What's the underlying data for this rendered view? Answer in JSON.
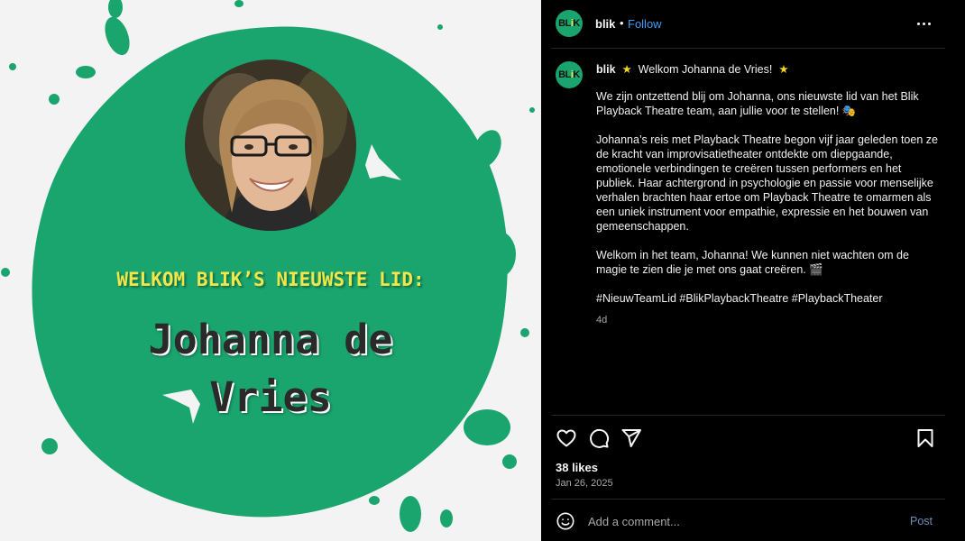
{
  "media": {
    "headline": "WELKOM BLIK’S NIEUWSTE LID:",
    "name": "Johanna de Vries",
    "colors": {
      "splash": "#1aa56e",
      "background": "#f3f3f3",
      "headline": "#f2e64a",
      "name": "#2a2a2a"
    }
  },
  "header": {
    "avatar_text_pre": "BL",
    "avatar_text_accent": "i",
    "avatar_text_post": "K",
    "username": "blik",
    "separator": "•",
    "follow_label": "Follow",
    "more_icon": "more-horizontal-icon"
  },
  "caption": {
    "username": "blik",
    "title": "Welkom Johanna de Vries!",
    "star": "★",
    "paragraph1": "We zijn ontzettend blij om Johanna, ons nieuwste lid van het Blik Playback Theatre team, aan jullie voor te stellen! 🎭",
    "paragraph2": "Johanna’s reis met Playback Theatre begon vijf jaar geleden toen ze de kracht van improvisatietheater ontdekte om diepgaande, emotionele verbindingen te creëren tussen performers en het publiek. Haar achtergrond in psychologie en passie voor menselijke verhalen brachten haar ertoe om Playback Theatre te omarmen als een uniek instrument voor empathie, expressie en het bouwen van gemeenschappen.",
    "paragraph3": "Welkom in het team, Johanna! We kunnen niet wachten om de magie te zien die je met ons gaat creëren. 🎬",
    "hashtags": "#NieuwTeamLid #BlikPlaybackTheatre #PlaybackTheater",
    "age": "4d"
  },
  "actions": {
    "like_icon": "heart-icon",
    "comment_icon": "comment-icon",
    "share_icon": "send-icon",
    "save_icon": "bookmark-icon"
  },
  "stats": {
    "likes": "38 likes",
    "date": "Jan 26, 2025"
  },
  "comment": {
    "emoji_icon": "smiley-icon",
    "placeholder": "Add a comment...",
    "post_label": "Post"
  }
}
